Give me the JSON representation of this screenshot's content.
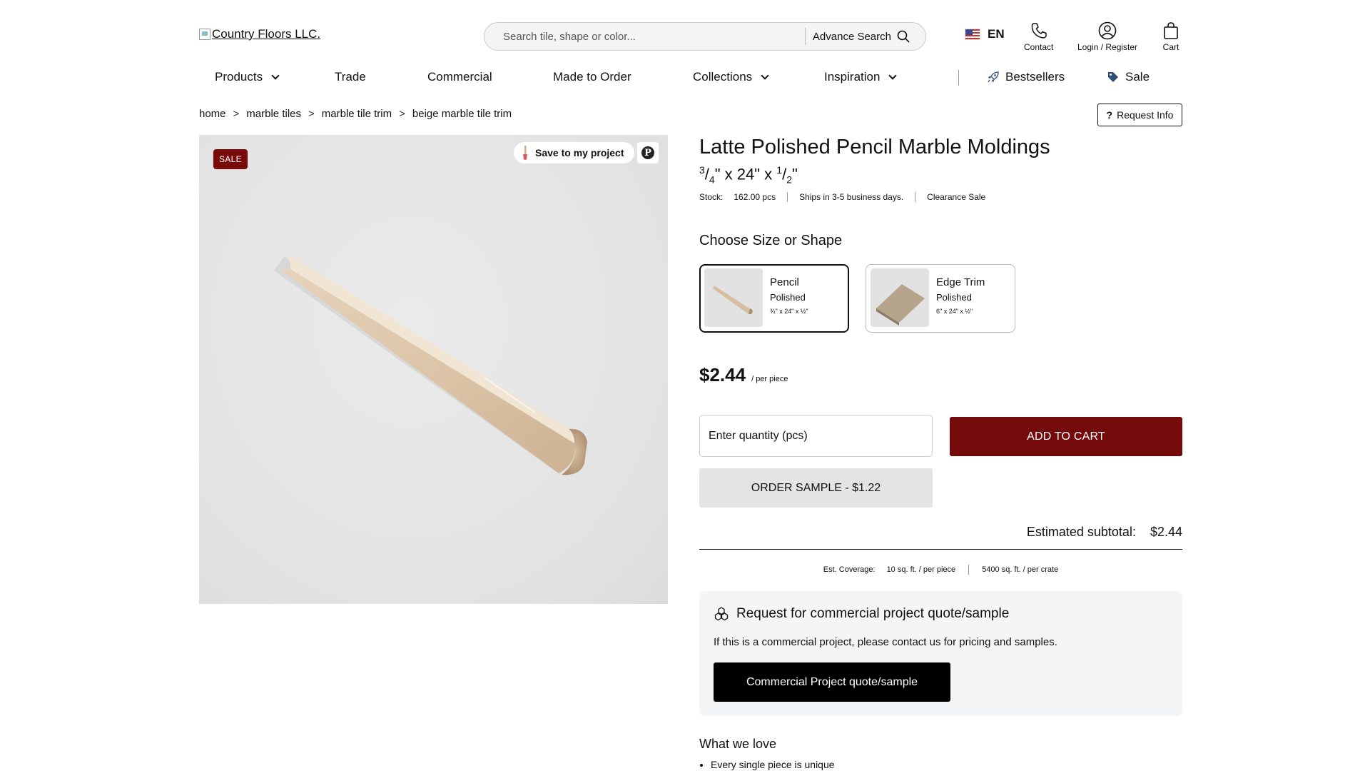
{
  "header": {
    "logo_alt": "Country Floors LLC.",
    "search_placeholder": "Search tile, shape or color...",
    "advance_search": "Advance Search",
    "language": "EN",
    "contact": "Contact",
    "login": "Login / Register",
    "cart": "Cart"
  },
  "nav": {
    "products": "Products",
    "trade": "Trade",
    "commercial": "Commercial",
    "made_to_order": "Made to Order",
    "collections": "Collections",
    "inspiration": "Inspiration",
    "bestsellers": "Bestsellers",
    "sale": "Sale"
  },
  "breadcrumb": [
    "home",
    "marble tiles",
    "marble tile trim",
    "beige marble tile trim"
  ],
  "breadcrumb_sep": ">",
  "request_info": "Request Info",
  "image": {
    "sale_badge": "SALE",
    "save_project": "Save to my project",
    "pinterest": "P"
  },
  "product": {
    "title": "Latte Polished Pencil Marble Moldings",
    "dims": {
      "a_num": "3",
      "a_den": "4",
      "b": "24",
      "c_num": "1",
      "c_den": "2"
    },
    "stock_label": "Stock:",
    "stock_value": "162.00 pcs",
    "ships": "Ships in 3-5 business days.",
    "clearance": "Clearance Sale"
  },
  "choose_label": "Choose Size or Shape",
  "options": [
    {
      "name": "Pencil",
      "finish": "Polished",
      "size": "¾\" x 24\" x ½\""
    },
    {
      "name": "Edge Trim",
      "finish": "Polished",
      "size": "6\" x 24\" x ½\""
    }
  ],
  "price": {
    "amount": "$2.44",
    "unit": "/ per piece"
  },
  "qty_placeholder": "Enter quantity (pcs)",
  "add_to_cart": "ADD TO CART",
  "order_sample": "ORDER SAMPLE - $1.22",
  "subtotal": {
    "label": "Estimated subtotal:",
    "value": "$2.44"
  },
  "coverage": {
    "label": "Est. Coverage:",
    "per_piece": "10 sq. ft. / per piece",
    "per_crate": "5400 sq. ft. / per crate"
  },
  "commercial": {
    "heading": "Request for commercial project quote/sample",
    "body": "If this is a commercial project, please contact us for pricing and samples.",
    "button": "Commercial Project quote/sample"
  },
  "love": {
    "heading": "What we love",
    "items": [
      "Every single piece is unique"
    ]
  },
  "colors": {
    "brand_red": "#750a0a",
    "sale_red": "#7a0a0a",
    "black": "#000000"
  }
}
